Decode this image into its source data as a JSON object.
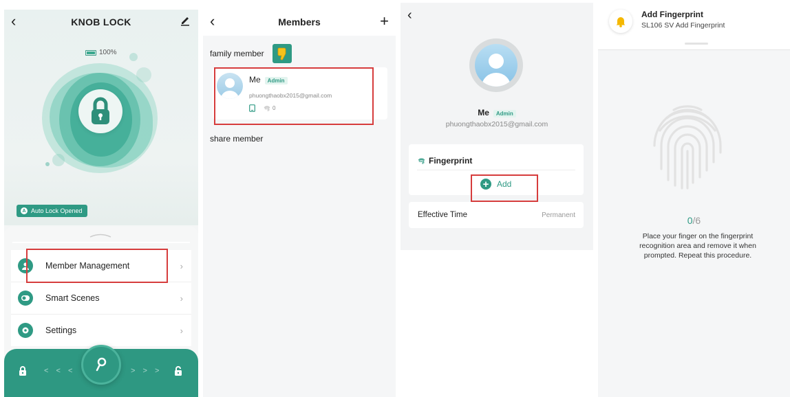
{
  "colors": {
    "accent": "#2f9a84",
    "highlight": "#d63c3c",
    "bell": "#f5b800"
  },
  "lock_screen": {
    "title": "KNOB LOCK",
    "battery": "100%",
    "auto_lock_status": "Auto Lock Opened",
    "menu": [
      {
        "label": "Member Management",
        "icon": "person-icon"
      },
      {
        "label": "Smart Scenes",
        "icon": "toggle-icon"
      },
      {
        "label": "Settings",
        "icon": "gear-icon"
      }
    ],
    "slider": {
      "left_arrows": "< < <",
      "right_arrows": "> > >"
    }
  },
  "members_screen": {
    "title": "Members",
    "family_label": "family member",
    "member": {
      "name": "Me",
      "role": "Admin",
      "email": "phuongthaobx2015@gmail.com",
      "fingerprint_count": "0"
    },
    "share_label": "share member"
  },
  "member_detail": {
    "name": "Me",
    "role": "Admin",
    "email": "phuongthaobx2015@gmail.com",
    "fingerprint_title": "Fingerprint",
    "add_label": "Add",
    "effective_time_label": "Effective Time",
    "effective_time_value": "Permanent"
  },
  "add_fingerprint": {
    "title": "Add Fingerprint",
    "subtitle": "SL106 SV Add Fingerprint",
    "progress_current": "0",
    "progress_total": "/6",
    "instructions": "Place your finger on the fingerprint recognition area and remove it when prompted. Repeat this procedure."
  }
}
